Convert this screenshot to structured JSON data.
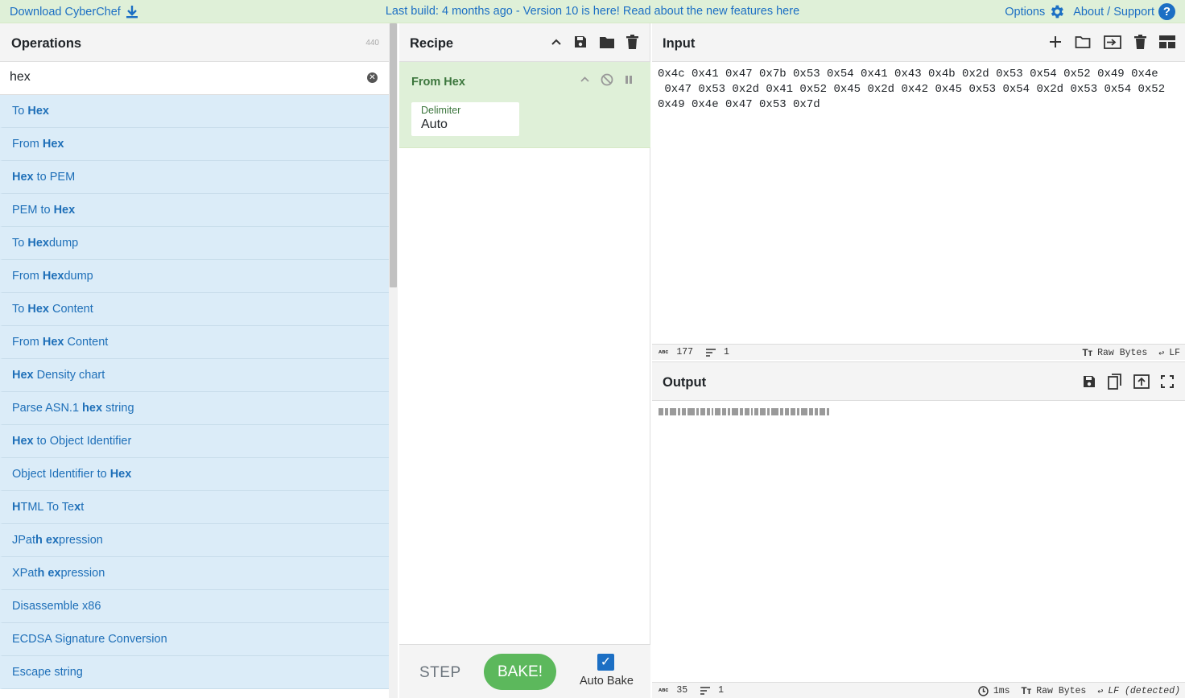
{
  "banner": {
    "download_label": "Download CyberChef",
    "build_message": "Last build: 4 months ago - Version 10 is here! Read about the new features here",
    "options_label": "Options",
    "about_label": "About / Support"
  },
  "operations": {
    "title": "Operations",
    "count": "440",
    "search_value": "hex",
    "items": [
      {
        "pre": "To ",
        "hl": "Hex",
        "post": ""
      },
      {
        "pre": "From ",
        "hl": "Hex",
        "post": ""
      },
      {
        "pre": "",
        "hl": "Hex",
        "post": " to PEM"
      },
      {
        "pre": "PEM to ",
        "hl": "Hex",
        "post": ""
      },
      {
        "pre": "To ",
        "hl": "Hex",
        "post": "dump"
      },
      {
        "pre": "From ",
        "hl": "Hex",
        "post": "dump"
      },
      {
        "pre": "To ",
        "hl": "Hex",
        "post": " Content"
      },
      {
        "pre": "From ",
        "hl": "Hex",
        "post": " Content"
      },
      {
        "pre": "",
        "hl": "Hex",
        "post": " Density chart"
      },
      {
        "pre": "Parse ASN.1 ",
        "hl": "hex",
        "post": " string"
      },
      {
        "pre": "",
        "hl": "Hex",
        "post": " to Object Identifier"
      },
      {
        "pre": "Object Identifier to ",
        "hl": "Hex",
        "post": ""
      },
      {
        "pre": "",
        "hl": "H",
        "post": "TML To Te",
        "hl2": "x",
        "post2": "t"
      },
      {
        "pre": "JPat",
        "hl": "h ex",
        "post": "pression"
      },
      {
        "pre": "XPat",
        "hl": "h ex",
        "post": "pression"
      },
      {
        "pre": "Disassemble x86",
        "hl": "",
        "post": ""
      },
      {
        "pre": "ECDSA Signature Conversion",
        "hl": "",
        "post": ""
      },
      {
        "pre": "Escape string",
        "hl": "",
        "post": ""
      }
    ]
  },
  "recipe": {
    "title": "Recipe",
    "operation_name": "From Hex",
    "delimiter_label": "Delimiter",
    "delimiter_value": "Auto",
    "step_label": "STEP",
    "bake_label": "BAKE!",
    "auto_bake_label": "Auto Bake",
    "auto_bake_checked": true
  },
  "input": {
    "title": "Input",
    "text": "0x4c 0x41 0x47 0x7b 0x53 0x54 0x41 0x43 0x4b 0x2d 0x53 0x54 0x52 0x49 0x4e\n 0x47 0x53 0x2d 0x41 0x52 0x45 0x2d 0x42 0x45 0x53 0x54 0x2d 0x53 0x54 0x52\n0x49 0x4e 0x47 0x53 0x7d",
    "char_count": "177",
    "line_count": "1",
    "encoding": "Raw Bytes",
    "eol": "LF"
  },
  "output": {
    "title": "Output",
    "char_count": "35",
    "line_count": "1",
    "time": "1ms",
    "encoding": "Raw Bytes",
    "eol": "LF (detected)"
  },
  "colors": {
    "banner_bg": "#dff0d8",
    "link_blue": "#1c6fc4",
    "op_item_bg": "#dbecf8",
    "recipe_op_bg": "#dff0d8",
    "bake_green": "#5cb85c"
  }
}
